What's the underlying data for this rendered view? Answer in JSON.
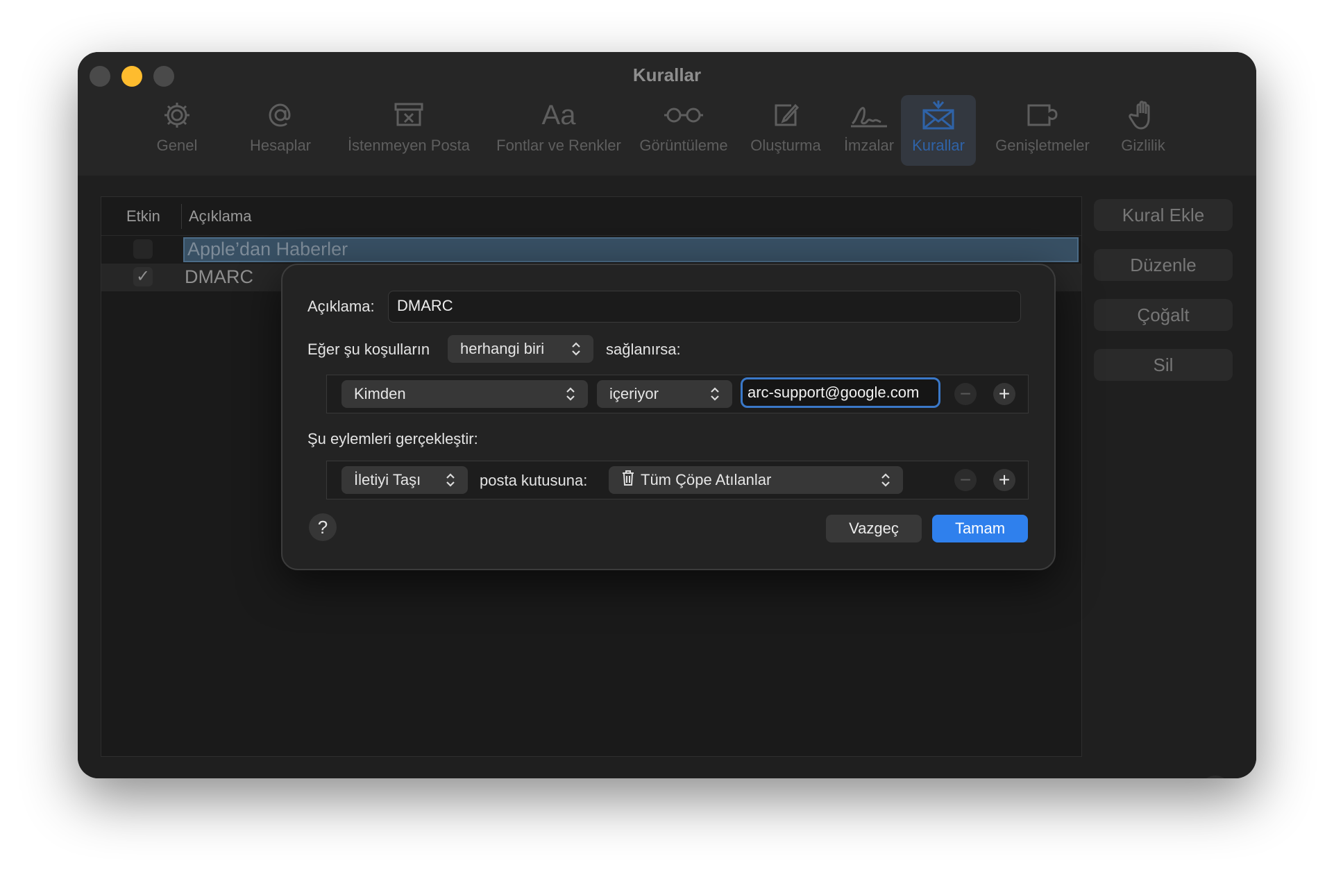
{
  "window": {
    "title": "Kurallar"
  },
  "toolbar": {
    "tabs": [
      {
        "label": "Genel",
        "icon": "gear-icon"
      },
      {
        "label": "Hesaplar",
        "icon": "at-sign-icon"
      },
      {
        "label": "İstenmeyen Posta",
        "icon": "junk-tray-icon"
      },
      {
        "label": "Fontlar ve Renkler",
        "icon": "font-aa-icon"
      },
      {
        "label": "Görüntüleme",
        "icon": "glasses-icon"
      },
      {
        "label": "Oluşturma",
        "icon": "compose-icon"
      },
      {
        "label": "İmzalar",
        "icon": "signature-icon"
      },
      {
        "label": "Kurallar",
        "icon": "envelope-rules-icon",
        "active": true
      },
      {
        "label": "Genişletmeler",
        "icon": "puzzle-icon"
      },
      {
        "label": "Gizlilik",
        "icon": "hand-icon"
      }
    ]
  },
  "rules_list": {
    "columns": {
      "enabled": "Etkin",
      "description": "Açıklama"
    },
    "rows": [
      {
        "enabled": false,
        "description": "Apple’dan Haberler",
        "selected": true
      },
      {
        "enabled": true,
        "description": "DMARC",
        "selected": false
      }
    ]
  },
  "side_buttons": {
    "add": "Kural Ekle",
    "edit": "Düzenle",
    "duplicate": "Çoğalt",
    "delete": "Sil"
  },
  "window_help": "?",
  "sheet": {
    "description_label": "Açıklama:",
    "description_value": "DMARC",
    "condition_prefix": "Eğer şu koşulların",
    "condition_match": "herhangi biri",
    "condition_suffix": "sağlanırsa:",
    "condition": {
      "field": "Kimden",
      "operator": "içeriyor",
      "value": "arc-support@google.com"
    },
    "actions_label": "Şu eylemleri gerçekleştir:",
    "action": {
      "type": "İletiyi Taşı",
      "target_label": "posta kutusuna:",
      "mailbox": "Tüm Çöpe Atılanlar"
    },
    "help": "?",
    "cancel": "Vazgeç",
    "ok": "Tamam"
  },
  "colors": {
    "accent": "#2f80ed",
    "focus_ring": "#3a78c8",
    "minimize": "#febc2e"
  }
}
